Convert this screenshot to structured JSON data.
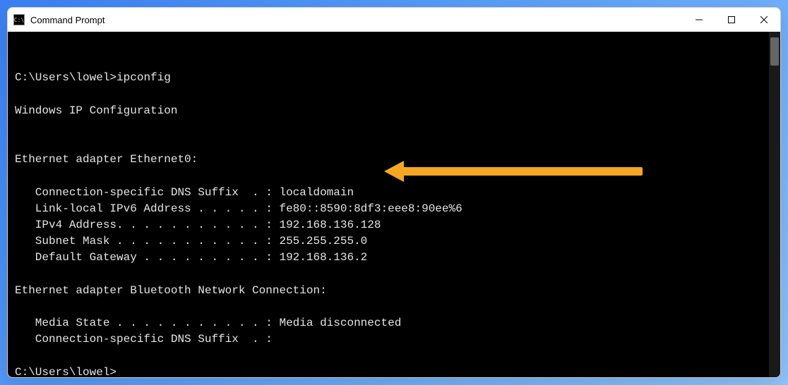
{
  "window": {
    "title": "Command Prompt",
    "iconGlyph": "C:\\"
  },
  "terminal": {
    "prompt1": "C:\\Users\\lowel>",
    "command1": "ipconfig",
    "blank1": "",
    "header": "Windows IP Configuration",
    "blank2": "",
    "blank3": "",
    "adapter1Header": "Ethernet adapter Ethernet0:",
    "blank4": "",
    "a1_line1": "   Connection-specific DNS Suffix  . : localdomain",
    "a1_line2": "   Link-local IPv6 Address . . . . . : fe80::8590:8df3:eee8:90ee%6",
    "a1_line3": "   IPv4 Address. . . . . . . . . . . : 192.168.136.128",
    "a1_line4": "   Subnet Mask . . . . . . . . . . . : 255.255.255.0",
    "a1_line5": "   Default Gateway . . . . . . . . . : 192.168.136.2",
    "blank5": "",
    "adapter2Header": "Ethernet adapter Bluetooth Network Connection:",
    "blank6": "",
    "a2_line1": "   Media State . . . . . . . . . . . : Media disconnected",
    "a2_line2": "   Connection-specific DNS Suffix  . :",
    "blank7": "",
    "prompt2": "C:\\Users\\lowel>"
  },
  "annotation": {
    "target": "IPv4 Address",
    "color": "#f5a623"
  }
}
